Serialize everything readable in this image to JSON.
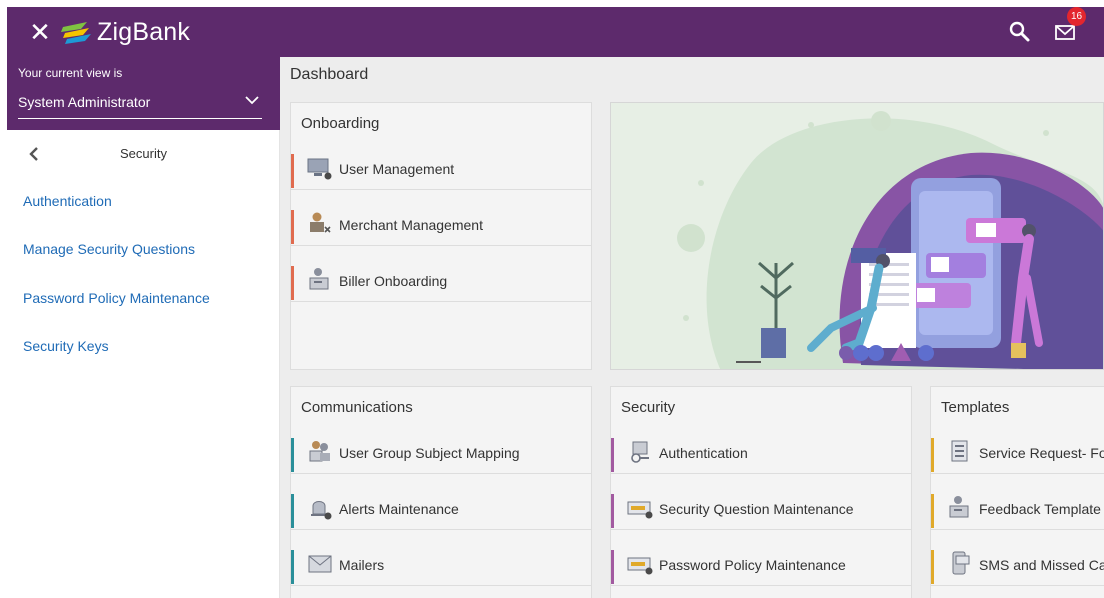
{
  "app": {
    "name": "ZigBank",
    "notification_count": "16",
    "colors": {
      "brand": "#5d2a6c",
      "link": "#1f6bb6",
      "badge": "#e3262e"
    }
  },
  "header": {
    "icons": [
      "close-icon",
      "zigbank-logo",
      "search-icon",
      "mail-icon"
    ]
  },
  "sidebar": {
    "view_label": "Your current view is",
    "view_value": "System Administrator",
    "section_title": "Security",
    "links": [
      "Authentication",
      "Manage Security Questions",
      "Password Policy Maintenance",
      "Security Keys"
    ]
  },
  "main": {
    "title": "Dashboard",
    "onboarding": {
      "title": "Onboarding",
      "items": [
        "User Management",
        "Merchant Management",
        "Biller Onboarding"
      ],
      "bar_color": "#e06b4f"
    },
    "communications": {
      "title": "Communications",
      "items": [
        "User Group Subject Mapping",
        "Alerts Maintenance",
        "Mailers"
      ],
      "bar_color": "#2a8f9a"
    },
    "security": {
      "title": "Security",
      "items": [
        "Authentication",
        "Security Question Maintenance",
        "Password Policy Maintenance"
      ],
      "bar_color": "#a25aa0"
    },
    "templates": {
      "title": "Templates",
      "items": [
        "Service Request- Fo",
        "Feedback Template",
        "SMS and Missed Cal"
      ],
      "bar_color": "#e0a92a"
    }
  }
}
